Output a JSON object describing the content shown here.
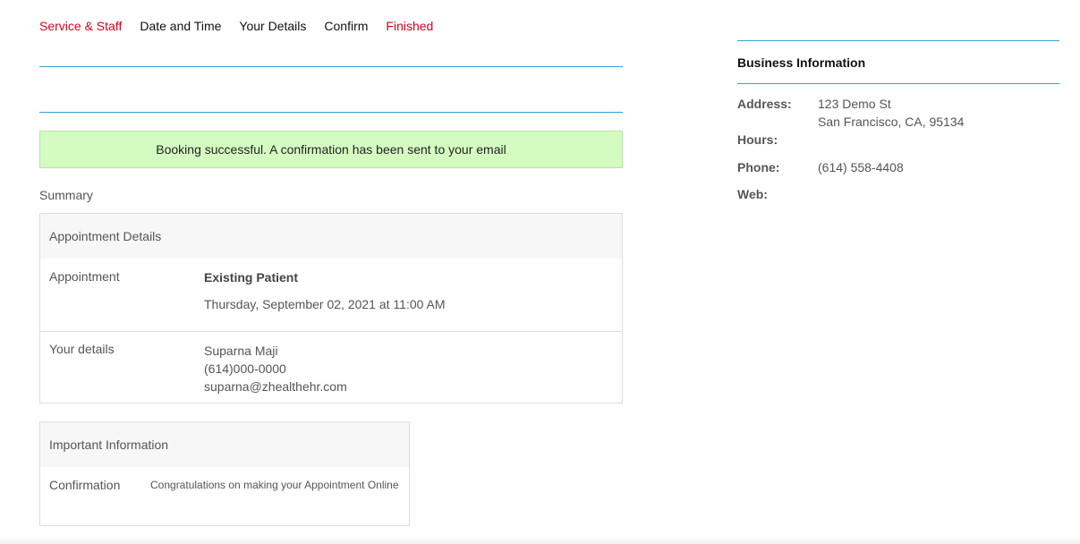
{
  "steps": [
    {
      "label": "Service & Staff",
      "color": "#d9001b"
    },
    {
      "label": "Date and Time",
      "color": "#111111"
    },
    {
      "label": "Your Details",
      "color": "#111111"
    },
    {
      "label": "Confirm",
      "color": "#111111"
    },
    {
      "label": "Finished",
      "color": "#d9001b"
    }
  ],
  "alert": {
    "message": "Booking successful. A confirmation has been sent to your email",
    "background": "#d4fcc1"
  },
  "summary": {
    "label": "Summary",
    "appointment_details": {
      "header": "Appointment Details",
      "appointment_label": "Appointment",
      "appointment_type": "Existing Patient",
      "appointment_datetime": "Thursday, September 02, 2021 at 11:00 AM",
      "your_details_label": "Your details",
      "name": "Suparna Maji",
      "phone": "(614)000-0000",
      "email": "suparna@zhealthehr.com"
    },
    "important_information": {
      "header": "Important Information",
      "confirmation_label": "Confirmation",
      "confirmation_text": "Congratulations on making your Appointment Online"
    }
  },
  "business": {
    "title": "Business Information",
    "address_label": "Address:",
    "address_line1": "123 Demo St",
    "address_line2": "San Francisco, CA, 95134",
    "hours_label": "Hours:",
    "phone_label": "Phone:",
    "phone": "(614) 558-4408",
    "web_label": "Web:"
  },
  "colors": {
    "accent_rule": "#2fa3d8",
    "active_step": "#d9001b"
  }
}
